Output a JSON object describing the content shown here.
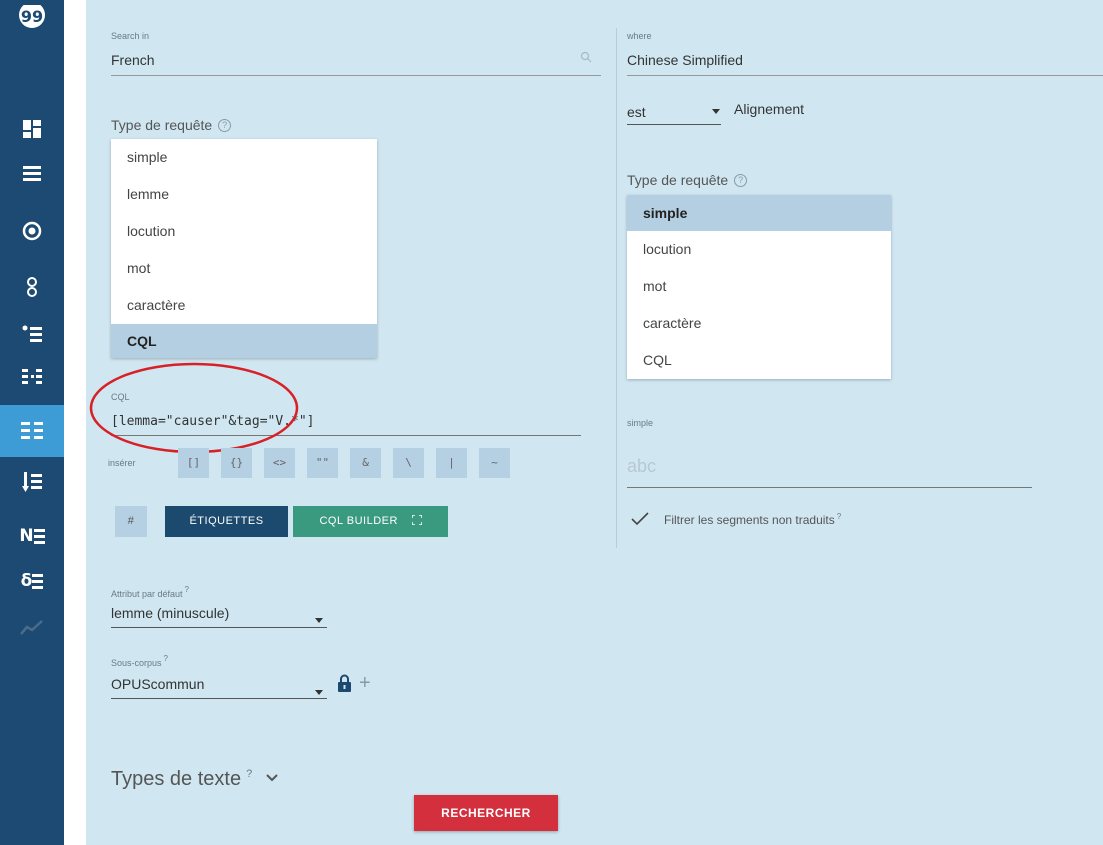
{
  "sidebar": {
    "items": [
      {
        "icon": "logo-icon"
      },
      {
        "icon": "dashboard-icon"
      },
      {
        "icon": "list-icon"
      },
      {
        "icon": "target-icon"
      },
      {
        "icon": "network-icon"
      },
      {
        "icon": "dot-list-icon"
      },
      {
        "icon": "compare-icon"
      },
      {
        "icon": "parallel-concordance-icon",
        "active": true
      },
      {
        "icon": "sort-list-icon"
      },
      {
        "icon": "ngrams-text",
        "text": "N"
      },
      {
        "icon": "keywords-text",
        "text": "δ"
      },
      {
        "icon": "trends-icon"
      }
    ]
  },
  "left": {
    "search_in_label": "Search in",
    "search_in_value": "French",
    "query_type_label": "Type de requête",
    "query_type_help": "?",
    "query_types": [
      "simple",
      "lemme",
      "locution",
      "mot",
      "caractère",
      "CQL"
    ],
    "selected_query_type": "CQL",
    "cql_label": "CQL",
    "cql_value": "[lemma=\"causer\"&tag=\"V.*\"]",
    "insert_label": "insérer",
    "insert_buttons": [
      "[]",
      "{}",
      "<>",
      "\"\"",
      "&",
      "\\",
      "|",
      "~"
    ],
    "hash_button": "#",
    "tags_button": "ÉTIQUETTES",
    "cql_builder_button": "CQL BUILDER",
    "default_attr_label": "Attribut par défaut",
    "default_attr_value": "lemme (minuscule)",
    "subcorpus_label": "Sous-corpus",
    "subcorpus_value": "OPUScommun",
    "help_mark": "?",
    "text_types_label": "Types de texte",
    "search_button": "RECHERCHER"
  },
  "right": {
    "where_label": "where",
    "where_value": "Chinese Simplified",
    "est_value": "est",
    "alignment_label": "Alignement",
    "query_type_label": "Type de requête",
    "query_type_help": "?",
    "query_types": [
      "simple",
      "locution",
      "mot",
      "caractère",
      "CQL"
    ],
    "selected_query_type": "simple",
    "simple_label": "simple",
    "simple_placeholder": "abc",
    "filter_label": "Filtrer les segments non traduits",
    "help_mark": "?"
  },
  "colors": {
    "sidebar_bg": "#1d4a72",
    "sidebar_active": "#3d9bd6",
    "panel_bg": "#d0e7f2",
    "tags_button": "#1b4a6e",
    "cql_builder_button": "#3a9a80",
    "search_button": "#d32f3d",
    "highlight_circle": "#d82027"
  }
}
